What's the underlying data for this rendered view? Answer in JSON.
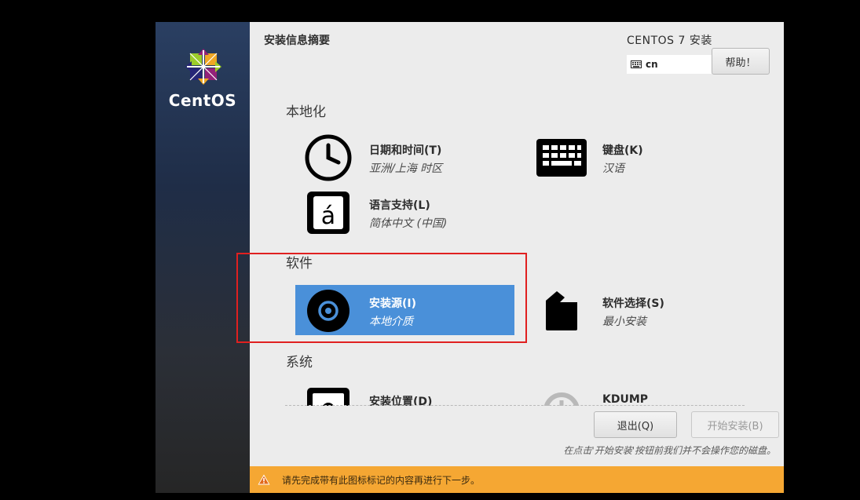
{
  "sidebar": {
    "brand": "CentOS"
  },
  "header": {
    "title": "安装信息摘要",
    "product": "CENTOS 7 安装",
    "keyboard_layout": "cn",
    "help_label": "帮助！"
  },
  "sections": {
    "localization": {
      "heading": "本地化",
      "datetime": {
        "title": "日期和时间(T)",
        "status": "亚洲/上海 时区"
      },
      "keyboard": {
        "title": "键盘(K)",
        "status": "汉语"
      },
      "language": {
        "title": "语言支持(L)",
        "status": "简体中文 (中国)"
      }
    },
    "software": {
      "heading": "软件",
      "source": {
        "title": "安装源(I)",
        "status": "本地介质"
      },
      "selection": {
        "title": "软件选择(S)",
        "status": "最小安装"
      }
    },
    "system": {
      "heading": "系统",
      "destination": {
        "title": "安装位置(D)"
      },
      "kdump": {
        "title": "KDUMP"
      }
    }
  },
  "footer": {
    "quit_label": "退出(Q)",
    "begin_label": "开始安装(B)",
    "hint": "在点击'开始安装'按钮前我们并不会操作您的磁盘。",
    "warning": "请先完成带有此图标标记的内容再进行下一步。"
  },
  "colors": {
    "accent": "#4a90d9",
    "warning": "#f5a733",
    "highlight": "#e02020"
  },
  "icons": [
    "centos-logo-icon",
    "keyboard-small-icon",
    "clock-icon",
    "keyboard-icon",
    "language-icon",
    "disc-icon",
    "package-icon",
    "disk-icon",
    "kdump-icon",
    "warning-icon"
  ]
}
